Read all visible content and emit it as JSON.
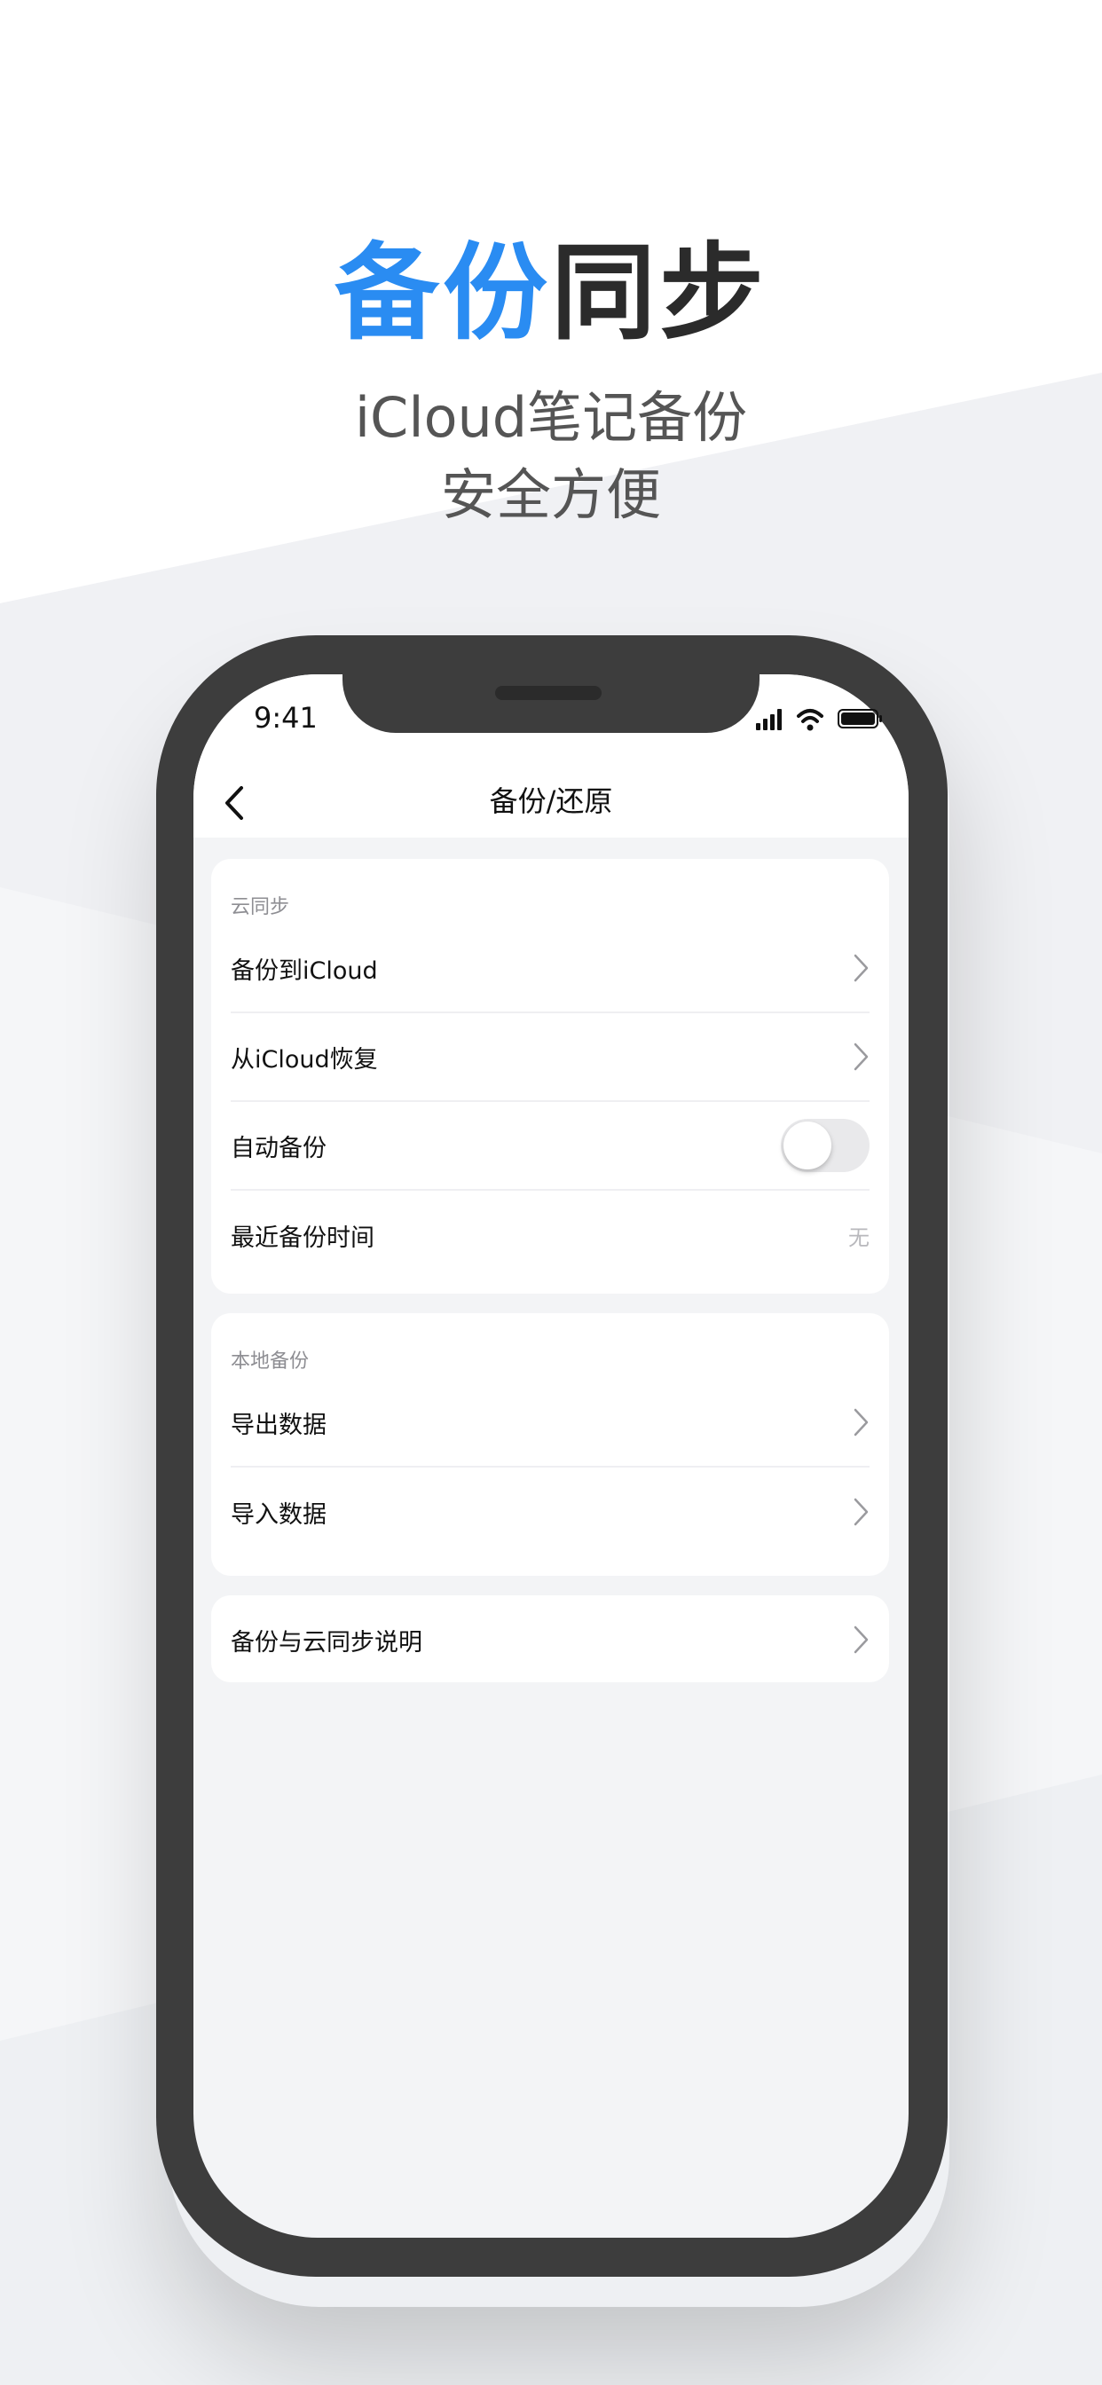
{
  "promo": {
    "headline_accent": "备份",
    "headline_dark": "同步",
    "subline_1": "iCloud笔记备份",
    "subline_2": "安全方便"
  },
  "status_bar": {
    "time": "9:41",
    "icons": [
      "signal-icon",
      "wifi-icon",
      "battery-icon"
    ]
  },
  "nav": {
    "title": "备份/还原",
    "back_icon": "chevron-left-icon"
  },
  "cloud_section": {
    "label": "云同步",
    "items": [
      {
        "label": "备份到iCloud",
        "accessory": "chevron-right-icon"
      },
      {
        "label": "从iCloud恢复",
        "accessory": "chevron-right-icon"
      },
      {
        "label": "自动备份",
        "accessory": "toggle",
        "toggle_on": false
      },
      {
        "label": "最近备份时间",
        "value": "无"
      }
    ]
  },
  "local_section": {
    "label": "本地备份",
    "items": [
      {
        "label": "导出数据",
        "accessory": "chevron-right-icon"
      },
      {
        "label": "导入数据",
        "accessory": "chevron-right-icon"
      }
    ]
  },
  "help_section": {
    "items": [
      {
        "label": "备份与云同步说明",
        "accessory": "chevron-right-icon"
      }
    ]
  },
  "colors": {
    "accent": "#2a8cf2",
    "headline_dark": "#2b2b2b",
    "phone_frame": "#3d3d3d",
    "screen_bg": "#f3f4f6",
    "card_bg": "#ffffff"
  }
}
